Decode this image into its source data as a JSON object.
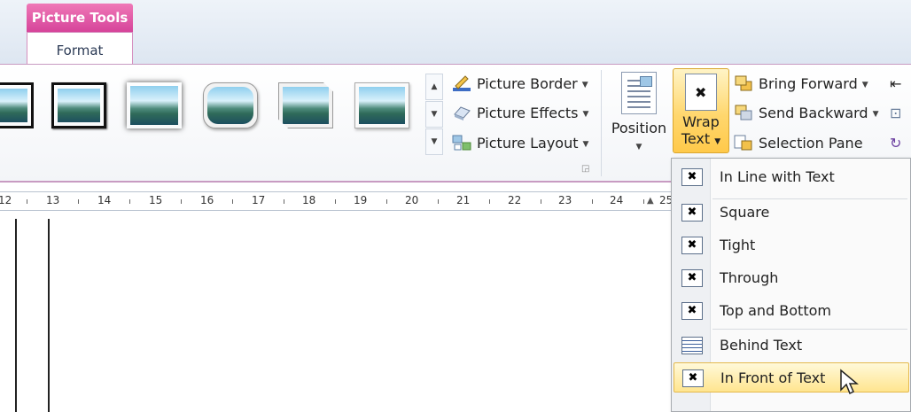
{
  "context_tab": {
    "header": "Picture Tools",
    "tab": "Format"
  },
  "picture_styles": {
    "commands": [
      {
        "label": "Picture Border",
        "icon": "pencil-icon"
      },
      {
        "label": "Picture Effects",
        "icon": "effects-icon"
      },
      {
        "label": "Picture Layout",
        "icon": "layout-icon"
      }
    ]
  },
  "arrange": {
    "position_label": "Position",
    "wrap_text_label_1": "Wrap",
    "wrap_text_label_2": "Text",
    "commands": [
      {
        "label": "Bring Forward",
        "icon": "bring-forward-icon"
      },
      {
        "label": "Send Backward",
        "icon": "send-backward-icon"
      },
      {
        "label": "Selection Pane",
        "icon": "selection-pane-icon"
      }
    ]
  },
  "ruler": {
    "ticks": [
      "12",
      "13",
      "14",
      "15",
      "16",
      "17",
      "18",
      "19",
      "20",
      "21",
      "22",
      "23",
      "24",
      "25"
    ]
  },
  "wrap_menu": {
    "items": [
      {
        "label": "In Line with Text"
      },
      {
        "label": "Square"
      },
      {
        "label": "Tight"
      },
      {
        "label": "Through"
      },
      {
        "label": "Top and Bottom"
      },
      {
        "label": "Behind Text"
      },
      {
        "label": "In Front of Text",
        "highlighted": true
      }
    ]
  },
  "colors": {
    "context_accent": "#d6449a",
    "hover": "#ffd76e"
  }
}
